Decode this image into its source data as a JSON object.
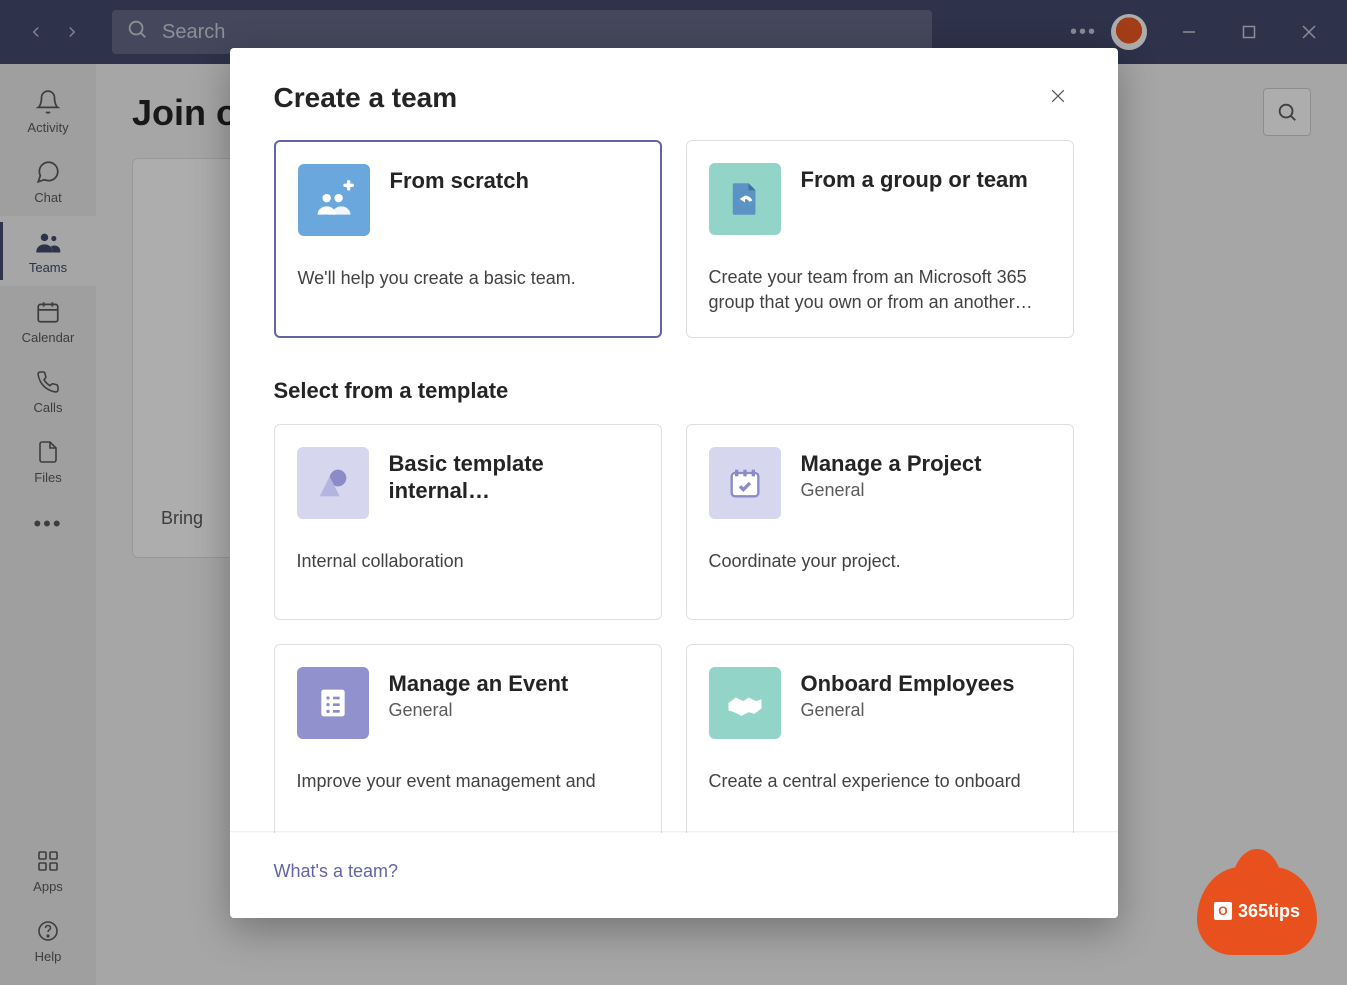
{
  "titlebar": {
    "search_placeholder": "Search"
  },
  "rail": {
    "items": [
      {
        "label": "Activity"
      },
      {
        "label": "Chat"
      },
      {
        "label": "Teams"
      },
      {
        "label": "Calendar"
      },
      {
        "label": "Calls"
      },
      {
        "label": "Files"
      }
    ],
    "apps_label": "Apps",
    "help_label": "Help"
  },
  "main": {
    "heading_partial": "Join o",
    "card_hint": "Bring "
  },
  "dialog": {
    "title": "Create a team",
    "top_cards": [
      {
        "title": "From scratch",
        "desc": "We'll help you create a basic team."
      },
      {
        "title": "From a group or team",
        "desc": "Create your team from an Microsoft 365 group that you own or from an another…"
      }
    ],
    "templates_heading": "Select from a template",
    "template_cards": [
      {
        "title": "Basic template internal…",
        "category": "",
        "desc": "Internal collaboration"
      },
      {
        "title": "Manage a Project",
        "category": "General",
        "desc": "Coordinate your project."
      },
      {
        "title": "Manage an Event",
        "category": "General",
        "desc": "Improve your event management and"
      },
      {
        "title": "Onboard Employees",
        "category": "General",
        "desc": "Create a central experience to onboard"
      }
    ],
    "footer_link": "What's a team?"
  },
  "brand": {
    "text": "365tips"
  }
}
